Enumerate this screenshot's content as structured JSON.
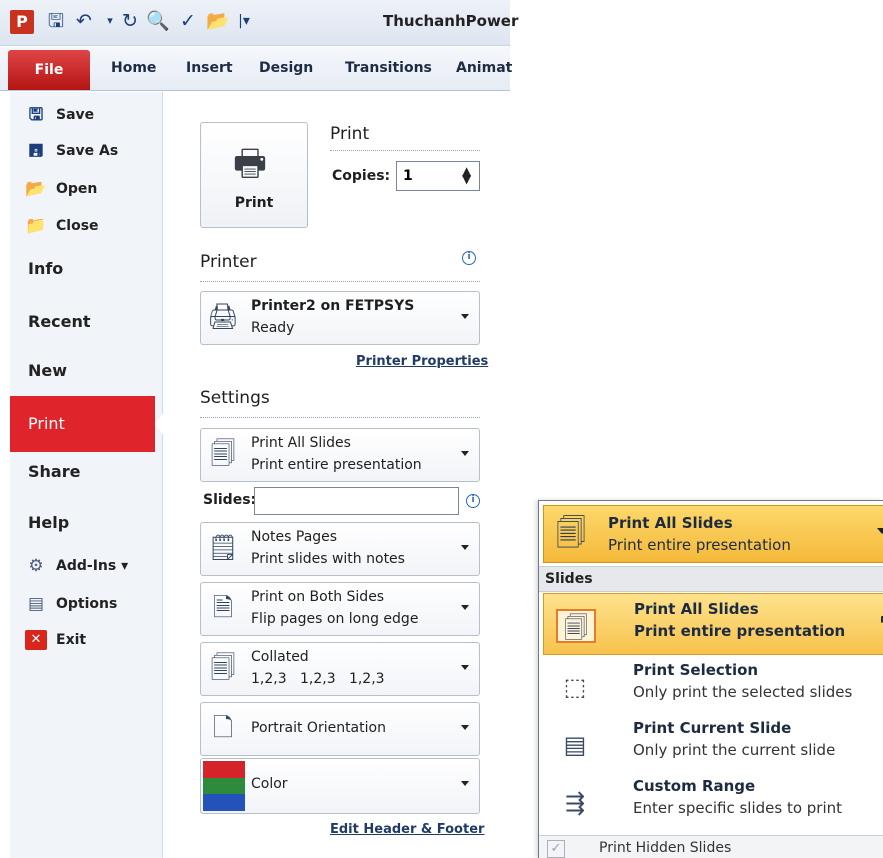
{
  "window": {
    "app_logo": "P",
    "title": "ThuchanhPower"
  },
  "qat": [
    "save-icon",
    "undo-icon",
    "redo-icon",
    "print-preview-icon",
    "spelling-icon",
    "open-icon"
  ],
  "tabs": {
    "file": "File",
    "home": "Home",
    "insert": "Insert",
    "design": "Design",
    "transitions": "Transitions",
    "animations": "Animat"
  },
  "nav": {
    "save": "Save",
    "save_as": "Save As",
    "open": "Open",
    "close": "Close",
    "info": "Info",
    "recent": "Recent",
    "new": "New",
    "print": "Print",
    "share": "Share",
    "help": "Help",
    "addins": "Add-Ins ▾",
    "options": "Options",
    "exit": "Exit"
  },
  "print": {
    "button_label": "Print",
    "heading": "Print",
    "copies_label": "Copies:",
    "copies_value": "1"
  },
  "printer": {
    "heading": "Printer",
    "name": "Printer2 on FETPSYS",
    "status": "Ready",
    "properties_link": "Printer Properties"
  },
  "settings": {
    "heading": "Settings",
    "slides_scope": {
      "title": "Print All Slides",
      "subtitle": "Print entire presentation"
    },
    "slides_label": "Slides:",
    "slides_value": "",
    "layout": {
      "title": "Notes Pages",
      "subtitle": "Print slides with notes"
    },
    "sides": {
      "title": "Print on Both Sides",
      "subtitle": "Flip pages on long edge"
    },
    "collation": {
      "title": "Collated",
      "subtitle": "1,2,3   1,2,3   1,2,3"
    },
    "orientation": {
      "title": "Portrait Orientation"
    },
    "color": {
      "title": "Color"
    },
    "header_footer_link": "Edit Header & Footer"
  },
  "popup": {
    "current": {
      "title": "Print All Slides",
      "subtitle": "Print entire presentation"
    },
    "section": "Slides",
    "items": [
      {
        "title": "Print All Slides",
        "subtitle": "Print entire presentation",
        "icon": "all-slides-icon",
        "highlighted": true
      },
      {
        "title": "Print Selection",
        "subtitle": "Only print the selected slides",
        "icon": "selection-icon",
        "highlighted": false
      },
      {
        "title": "Print Current Slide",
        "subtitle": "Only print the current slide",
        "icon": "current-slide-icon",
        "highlighted": false
      },
      {
        "title": "Custom Range",
        "subtitle": "Enter specific slides to print",
        "icon": "custom-range-icon",
        "highlighted": false
      }
    ],
    "hidden_slides": {
      "label": "Print Hidden Slides",
      "checked": true
    }
  },
  "colors": {
    "file_tab": "#c8231f",
    "print_nav": "#e0242b",
    "menu_highlight": "#f7c24d"
  }
}
